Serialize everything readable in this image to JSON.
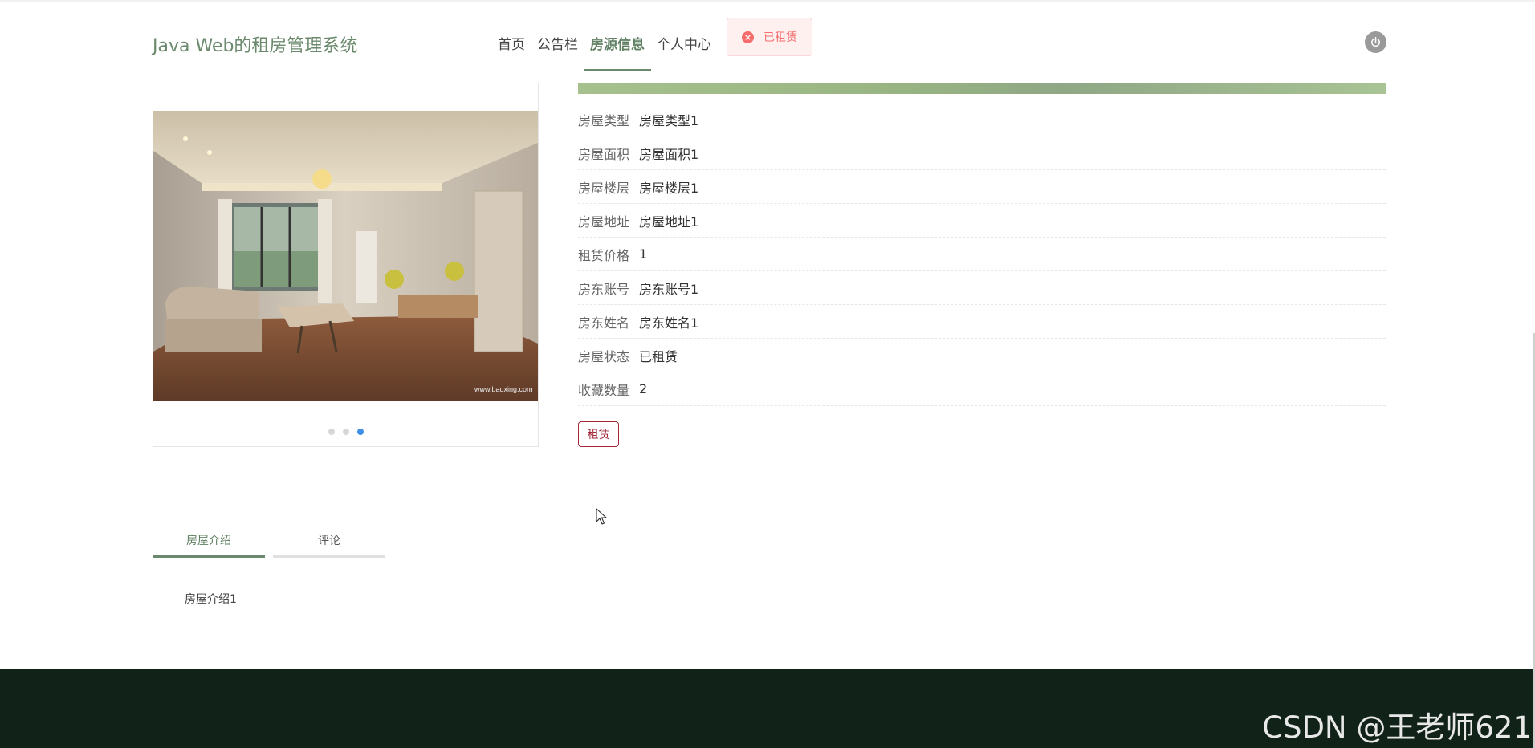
{
  "header": {
    "brand": "Java Web的租房管理系统",
    "nav": [
      {
        "label": "首页",
        "active": false
      },
      {
        "label": "公告栏",
        "active": false
      },
      {
        "label": "房源信息",
        "active": true
      },
      {
        "label": "个人中心",
        "active": false
      }
    ],
    "toast": {
      "text": "已租赁",
      "icon": "close-circle-icon",
      "color": "#f56c6c"
    },
    "power_icon": "power-icon"
  },
  "gallery": {
    "slides_count": 3,
    "active_index": 2,
    "photo_caption": "www.baoxing.com"
  },
  "details": {
    "rows": [
      {
        "label": "房屋类型",
        "value": "房屋类型1"
      },
      {
        "label": "房屋面积",
        "value": "房屋面积1"
      },
      {
        "label": "房屋楼层",
        "value": "房屋楼层1"
      },
      {
        "label": "房屋地址",
        "value": "房屋地址1"
      },
      {
        "label": "租赁价格",
        "value": "1"
      },
      {
        "label": "房东账号",
        "value": "房东账号1"
      },
      {
        "label": "房东姓名",
        "value": "房东姓名1"
      },
      {
        "label": "房屋状态",
        "value": "已租赁"
      },
      {
        "label": "收藏数量",
        "value": "2"
      }
    ],
    "rent_button": "租赁"
  },
  "tabs": {
    "items": [
      {
        "label": "房屋介绍",
        "active": true
      },
      {
        "label": "评论",
        "active": false
      }
    ],
    "content": "房屋介绍1"
  },
  "footer": {
    "watermark": "CSDN @王老师621"
  },
  "colors": {
    "brand": "#6b8a6d",
    "footer": "#112218",
    "rent_button": "#a2283a",
    "active_dot": "#3d8ee6"
  }
}
